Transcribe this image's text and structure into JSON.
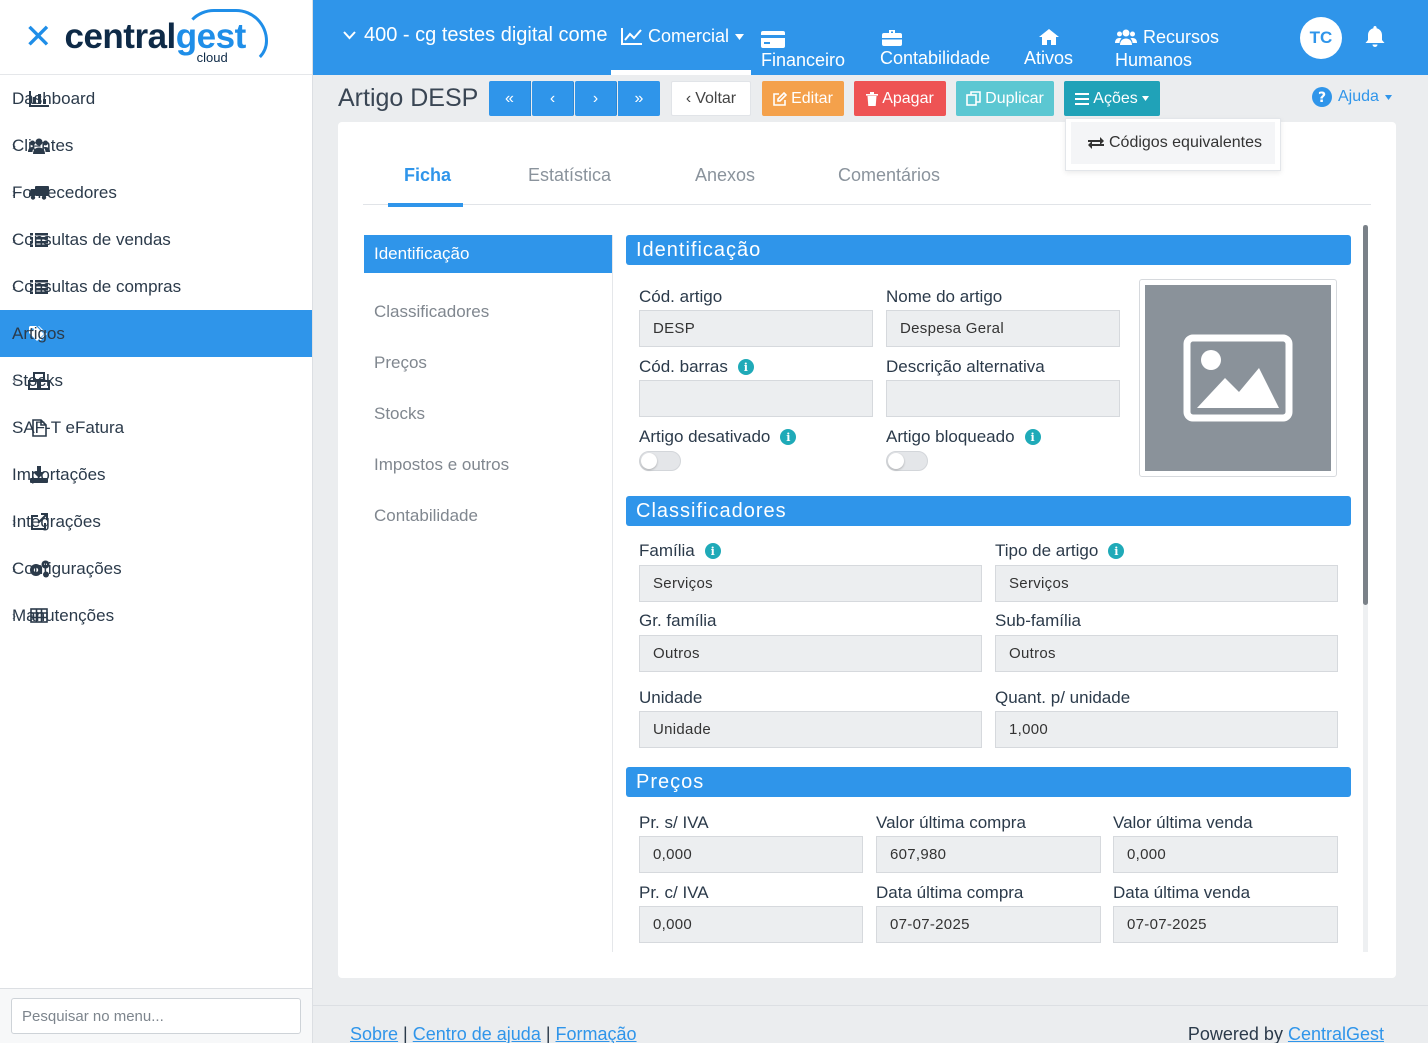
{
  "logo": {
    "brand_dark": "central",
    "brand_blue": "gest",
    "sub": "cloud"
  },
  "sidebar": {
    "items": [
      {
        "label": "Dashboard",
        "icon": "bar-chart-icon"
      },
      {
        "label": "Clientes",
        "icon": "users-icon"
      },
      {
        "label": "Fornecedores",
        "icon": "truck-icon"
      },
      {
        "label": "Consultas de vendas",
        "icon": "list-icon"
      },
      {
        "label": "Consultas de compras",
        "icon": "list-icon"
      },
      {
        "label": "Artigos",
        "icon": "tags-icon"
      },
      {
        "label": "Stocks",
        "icon": "cubes-icon"
      },
      {
        "label": "SAF-T eFatura",
        "icon": "file-icon"
      },
      {
        "label": "Importações",
        "icon": "download-icon"
      },
      {
        "label": "Integrações",
        "icon": "external-link-icon"
      },
      {
        "label": "Configurações",
        "icon": "gears-icon"
      },
      {
        "label": "Manutenções",
        "icon": "table-icon"
      }
    ],
    "search_placeholder": "Pesquisar no menu..."
  },
  "topbar": {
    "company": "400 - cg testes digital come",
    "nav": {
      "comercial": "Comercial",
      "financeiro": "Financeiro",
      "contabilidade": "Contabilidade",
      "ativos": "Ativos",
      "rh_line1": "Recursos",
      "rh_line2": "Humanos"
    },
    "avatar": "TC"
  },
  "toolbar": {
    "title": "Artigo DESP",
    "voltar": "Voltar",
    "editar": "Editar",
    "apagar": "Apagar",
    "duplicar": "Duplicar",
    "acoes": "Ações",
    "ajuda": "Ajuda",
    "dropdown_item": "Códigos equivalentes"
  },
  "tabs": [
    "Ficha",
    "Estatística",
    "Anexos",
    "Comentários"
  ],
  "subnav": [
    "Identificação",
    "Classificadores",
    "Preços",
    "Stocks",
    "Impostos e outros",
    "Contabilidade"
  ],
  "identificacao": {
    "header": "Identificação",
    "cod_artigo_label": "Cód. artigo",
    "cod_artigo_value": "DESP",
    "nome_label": "Nome do artigo",
    "nome_value": "Despesa Geral",
    "cod_barras_label": "Cód. barras",
    "cod_barras_value": "",
    "desc_alt_label": "Descrição alternativa",
    "desc_alt_value": "",
    "desativado_label": "Artigo desativado",
    "bloqueado_label": "Artigo bloqueado"
  },
  "classificadores": {
    "header": "Classificadores",
    "familia_label": "Família",
    "familia_value": "Serviços",
    "tipo_label": "Tipo de artigo",
    "tipo_value": "Serviços",
    "gr_familia_label": "Gr. família",
    "gr_familia_value": "Outros",
    "sub_familia_label": "Sub-família",
    "sub_familia_value": "Outros",
    "unidade_label": "Unidade",
    "unidade_value": "Unidade",
    "quant_label": "Quant. p/ unidade",
    "quant_value": "1,000"
  },
  "precos": {
    "header": "Preços",
    "pr_sem_iva_label": "Pr. s/ IVA",
    "pr_sem_iva_value": "0,000",
    "valor_ult_compra_label": "Valor última compra",
    "valor_ult_compra_value": "607,980",
    "valor_ult_venda_label": "Valor última venda",
    "valor_ult_venda_value": "0,000",
    "pr_com_iva_label": "Pr. c/ IVA",
    "pr_com_iva_value": "0,000",
    "data_ult_compra_label": "Data última compra",
    "data_ult_compra_value": "07-07-2025",
    "data_ult_venda_label": "Data última venda",
    "data_ult_venda_value": "07-07-2025"
  },
  "footer": {
    "sobre": "Sobre",
    "sep1": " | ",
    "centro": "Centro de ajuda",
    "sep2": " | ",
    "formacao": "Formação",
    "powered": "Powered by ",
    "brand": "CentralGest"
  },
  "colors": {
    "primary": "#2f95ea",
    "edit": "#f4a14b",
    "delete": "#ee5354",
    "duplicate": "#5bc7d2",
    "actions": "#20a2b8"
  }
}
